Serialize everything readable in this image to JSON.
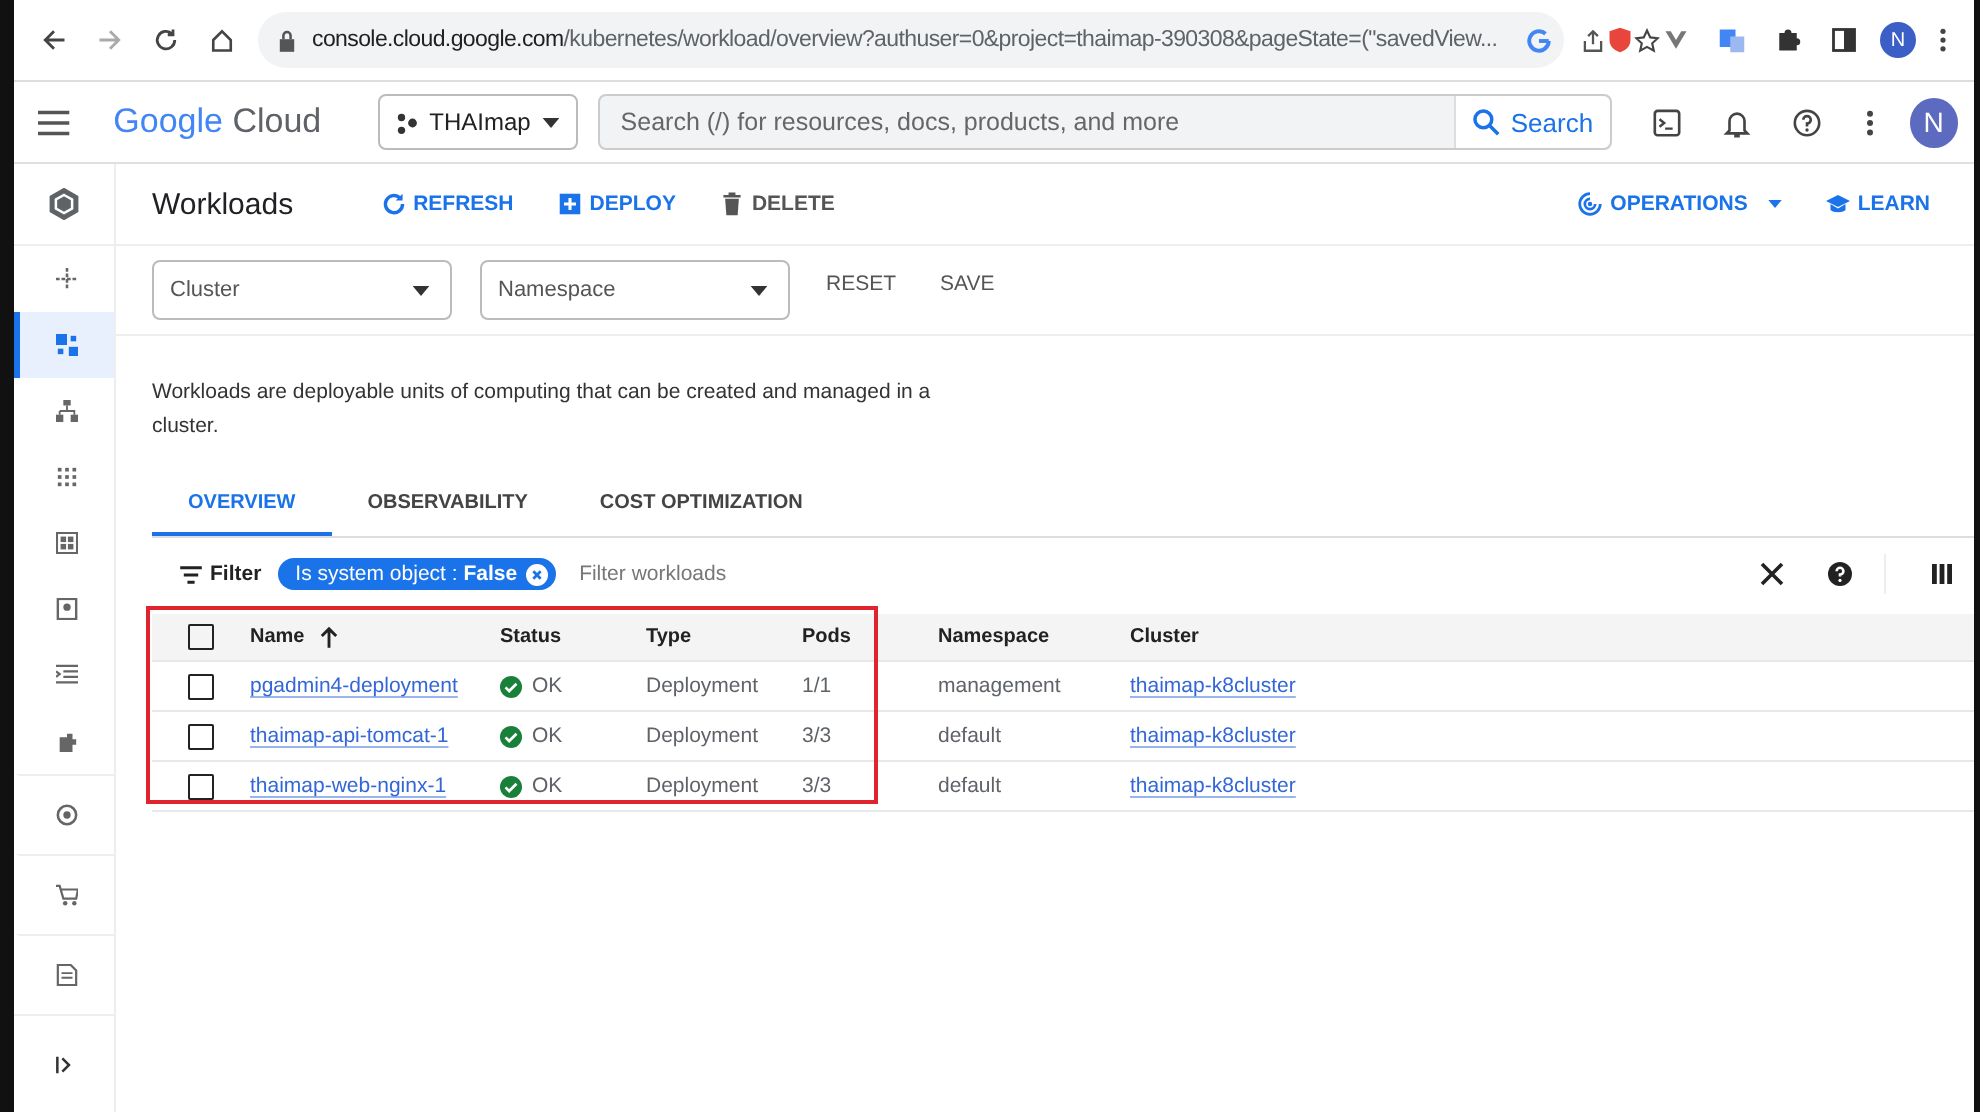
{
  "browser": {
    "url_host": "console.cloud.google.com",
    "url_path": "/kubernetes/workload/overview?authuser=0&project=thaimap-390308&pageState=(\"savedView...",
    "profile": "N"
  },
  "header": {
    "logo_google": "Google",
    "logo_product": "Cloud",
    "project": "THAImap",
    "search_placeholder": "Search (/) for resources, docs, products, and more",
    "search_button": "Search",
    "avatar": "N"
  },
  "sidebar": {
    "items": [
      {
        "selected": false
      },
      {
        "selected": true
      },
      {
        "selected": false
      },
      {
        "selected": false
      },
      {
        "selected": false
      },
      {
        "selected": false
      },
      {
        "selected": false
      },
      {
        "selected": false
      },
      {
        "selected": false
      },
      {
        "selected": false
      },
      {
        "selected": false
      }
    ]
  },
  "toolbar": {
    "title": "Workloads",
    "actions": [
      {
        "kind": "refresh",
        "label": "REFRESH"
      },
      {
        "kind": "deploy",
        "label": "DEPLOY"
      },
      {
        "kind": "delete",
        "label": "DELETE"
      }
    ],
    "right": [
      {
        "kind": "operations",
        "label": "OPERATIONS"
      },
      {
        "kind": "learn",
        "label": "LEARN"
      }
    ]
  },
  "filters": {
    "cluster_placeholder": "Cluster",
    "namespace_placeholder": "Namespace",
    "buttons": [
      "RESET",
      "SAVE"
    ]
  },
  "description": "Workloads are deployable units of computing that can be created and managed in a cluster.",
  "tabs": [
    {
      "label": "OVERVIEW",
      "selected": true
    },
    {
      "label": "OBSERVABILITY",
      "selected": false
    },
    {
      "label": "COST OPTIMIZATION",
      "selected": false
    }
  ],
  "filter_bar": {
    "label": "Filter",
    "chip": "Is system object : **False**",
    "placeholder": "Filter workloads"
  },
  "table": {
    "select_all_checked": false,
    "columns": [
      "Name",
      "Status",
      "Type",
      "Pods",
      "Namespace",
      "Cluster"
    ],
    "rows": [
      {
        "checked": false,
        "name": "pgadmin4-deployment",
        "status": "OK",
        "type": "Deployment",
        "pods": "1/1",
        "namespace": "management",
        "cluster": "thaimap-k8cluster"
      },
      {
        "checked": false,
        "name": "thaimap-api-tomcat-1",
        "status": "OK",
        "type": "Deployment",
        "pods": "3/3",
        "namespace": "default",
        "cluster": "thaimap-k8cluster"
      },
      {
        "checked": false,
        "name": "thaimap-web-nginx-1",
        "status": "OK",
        "type": "Deployment",
        "pods": "3/3",
        "namespace": "default",
        "cluster": "thaimap-k8cluster"
      }
    ]
  },
  "highlight": {
    "shown": true
  }
}
